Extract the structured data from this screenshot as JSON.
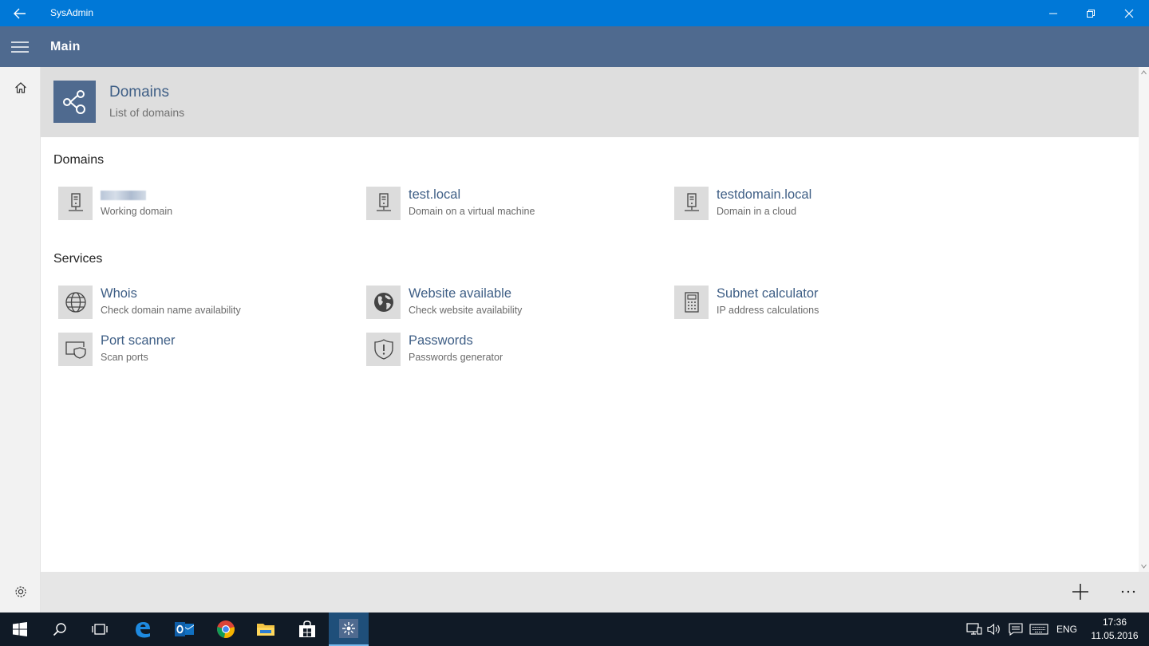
{
  "titlebar": {
    "app_name": "SysAdmin"
  },
  "header": {
    "title": "Main"
  },
  "banner": {
    "title": "Domains",
    "subtitle": "List of domains"
  },
  "sections": {
    "domains": {
      "title": "Domains",
      "items": [
        {
          "title": "",
          "subtitle": "Working domain",
          "icon": "server-icon"
        },
        {
          "title": "test.local",
          "subtitle": "Domain on a virtual machine",
          "icon": "server-icon"
        },
        {
          "title": "testdomain.local",
          "subtitle": "Domain in a cloud",
          "icon": "server-icon"
        }
      ]
    },
    "services": {
      "title": "Services",
      "items": [
        {
          "title": "Whois",
          "subtitle": "Check domain name availability",
          "icon": "globe-icon"
        },
        {
          "title": "Website available",
          "subtitle": "Check website availability",
          "icon": "world-icon"
        },
        {
          "title": "Subnet calculator",
          "subtitle": "IP address calculations",
          "icon": "calculator-icon"
        },
        {
          "title": "Port scanner",
          "subtitle": "Scan ports",
          "icon": "shield-screen-icon"
        },
        {
          "title": "Passwords",
          "subtitle": "Passwords generator",
          "icon": "shield-alert-icon"
        }
      ]
    }
  },
  "taskbar": {
    "apps": [
      "start-icon",
      "search-icon",
      "task-view-icon",
      "edge-icon",
      "outlook-icon",
      "chrome-icon",
      "file-explorer-icon",
      "store-icon",
      "sysadmin-app-icon"
    ],
    "language": "ENG",
    "time": "17:36",
    "date": "11.05.2016"
  },
  "colors": {
    "accent": "#0078d7",
    "header": "#4f6a8f",
    "link": "#3f5f86",
    "taskbar": "#101a26"
  }
}
